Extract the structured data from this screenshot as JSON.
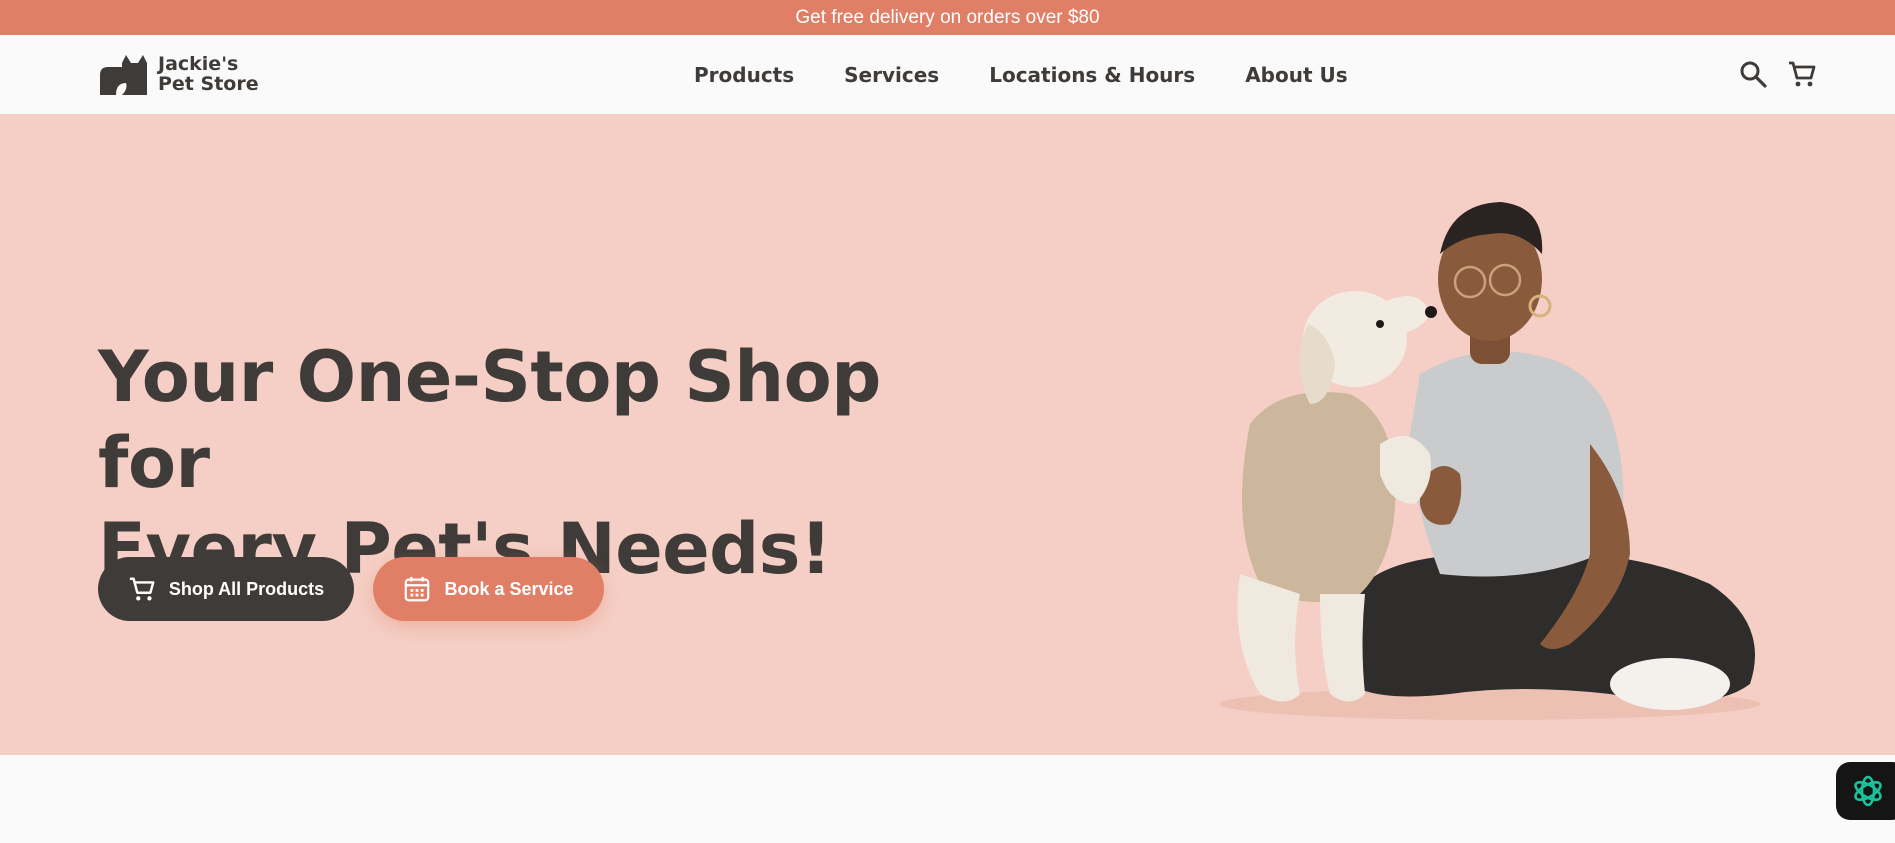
{
  "announcement": "Get free delivery on orders over $80",
  "brand": {
    "line1": "Jackie's",
    "line2": "Pet Store"
  },
  "nav": [
    "Products",
    "Services",
    "Locations & Hours",
    "About Us"
  ],
  "header_icons": [
    "search-icon",
    "cart-icon"
  ],
  "hero": {
    "headline_line1": "Your One-Stop Shop for",
    "headline_line2": "Every Pet's Needs!",
    "primary_button": "Shop All Products",
    "secondary_button": "Book a Service"
  },
  "colors": {
    "accent": "#e07f66",
    "hero_bg": "#f5cfc5",
    "dark": "#3f3b39",
    "page_bg": "#fafafa"
  }
}
